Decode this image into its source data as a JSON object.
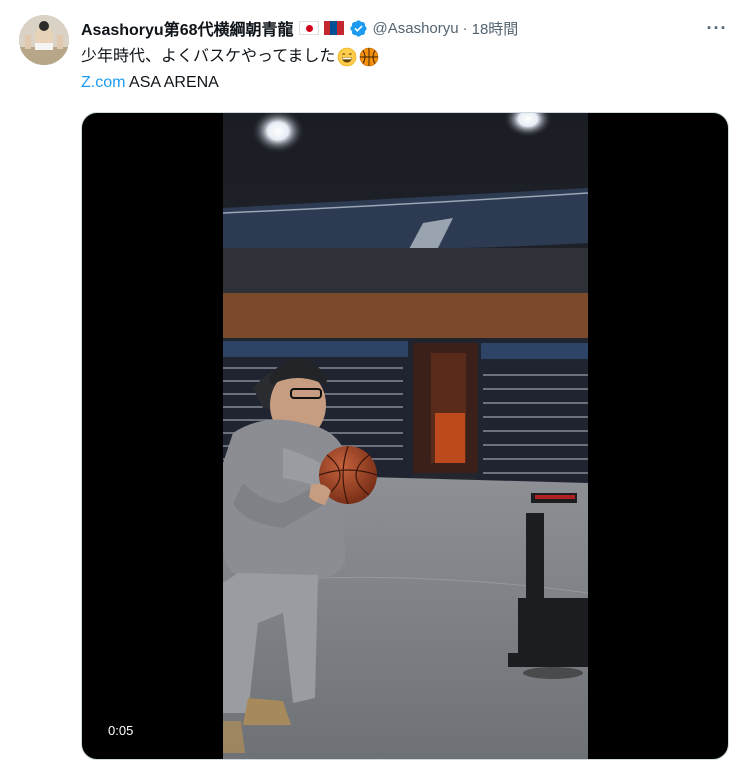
{
  "tweet": {
    "display_name": "Asashoryu第68代横綱朝青龍",
    "handle": "@Asashoryu",
    "separator": "·",
    "time": "18時間",
    "more_label": "···",
    "text": "少年時代、よくバスケやってました",
    "emoji": [
      "grinning-face",
      "basketball"
    ],
    "link_text": "Z.com",
    "link_suffix": " ASA ARENA",
    "video": {
      "timestamp": "0:05"
    }
  },
  "colors": {
    "accent": "#1d9bf0",
    "secondary_text": "#536471",
    "primary_text": "#0f1419"
  },
  "icons": {
    "verified": "verified-badge-icon",
    "flag_jp": "japan-flag-icon",
    "flag_mn": "mongolia-flag-icon",
    "more": "more-options-icon"
  }
}
